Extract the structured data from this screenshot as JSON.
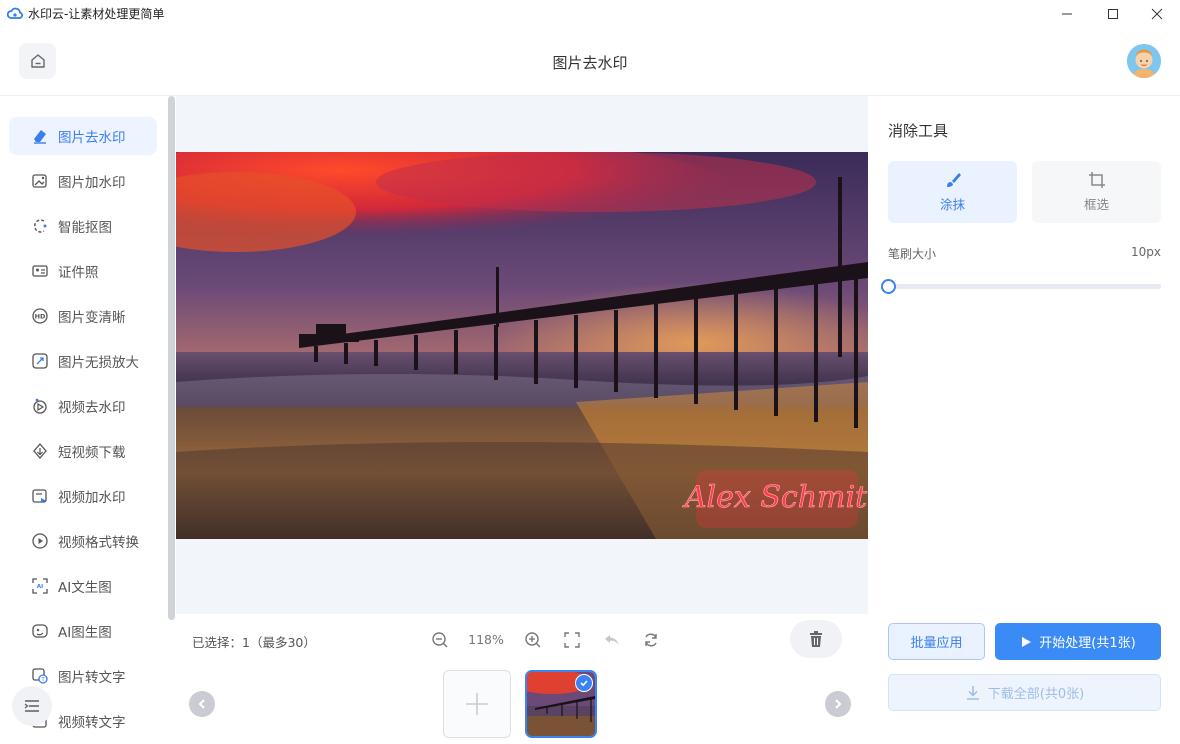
{
  "window": {
    "title": "水印云-让素材处理更简单"
  },
  "header": {
    "title": "图片去水印"
  },
  "sidebar": {
    "items": [
      {
        "label": "图片去水印",
        "icon": "eraser-icon",
        "active": true
      },
      {
        "label": "图片加水印",
        "icon": "image-add-icon"
      },
      {
        "label": "智能抠图",
        "icon": "cutout-icon"
      },
      {
        "label": "证件照",
        "icon": "id-card-icon"
      },
      {
        "label": "图片变清晰",
        "icon": "hd-icon"
      },
      {
        "label": "图片无损放大",
        "icon": "enlarge-icon"
      },
      {
        "label": "视频去水印",
        "icon": "video-eraser-icon"
      },
      {
        "label": "短视频下载",
        "icon": "video-download-icon"
      },
      {
        "label": "视频加水印",
        "icon": "video-add-icon"
      },
      {
        "label": "视频格式转换",
        "icon": "video-convert-icon"
      },
      {
        "label": "AI文生图",
        "icon": "ai-text-image-icon"
      },
      {
        "label": "AI图生图",
        "icon": "ai-image-image-icon"
      },
      {
        "label": "图片转文字",
        "icon": "ocr-icon"
      },
      {
        "label": "视频转文字",
        "icon": "video-text-icon"
      }
    ]
  },
  "photo": {
    "watermark_text": "Alex Schmit"
  },
  "toolbar": {
    "selected_info": "已选择：1（最多30）",
    "zoom": "118%"
  },
  "panel": {
    "heading": "消除工具",
    "mode_paint": "涂抹",
    "mode_box": "框选",
    "brush_label": "笔刷大小",
    "brush_value": "10px",
    "brush_level": 0.0,
    "batch_label": "批量应用",
    "start_label": "开始处理(共1张)",
    "download_label": "下载全部(共0张)"
  },
  "colors": {
    "accent": "#3b82f6",
    "active_bg": "#edf3ff"
  }
}
